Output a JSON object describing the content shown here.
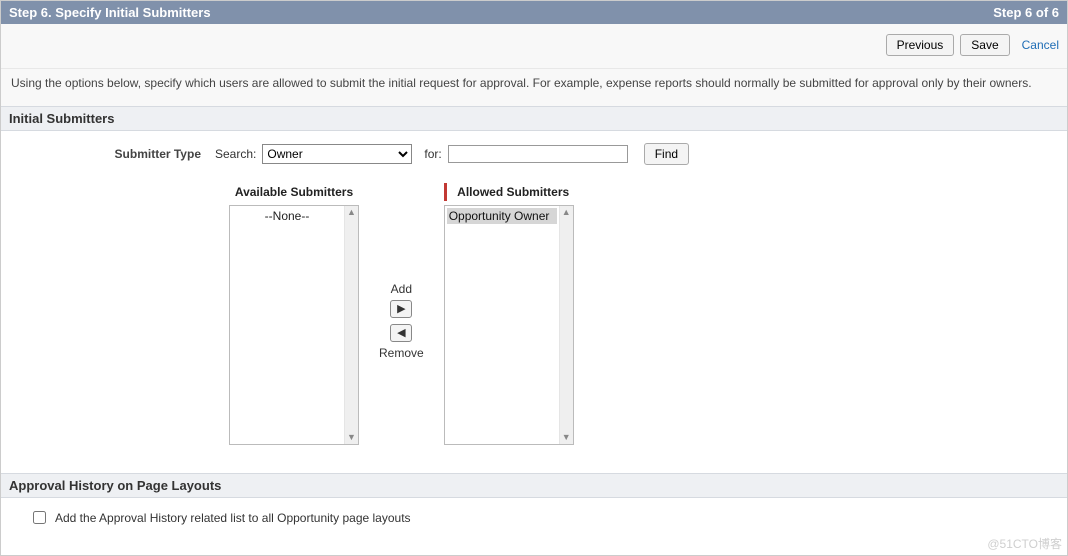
{
  "header": {
    "title": "Step 6. Specify Initial Submitters",
    "progress": "Step 6 of 6"
  },
  "toolbar": {
    "previous": "Previous",
    "save": "Save",
    "cancel": "Cancel"
  },
  "intro": "Using the options below, specify which users are allowed to submit the initial request for approval. For example, expense reports should normally be submitted for approval only by their owners.",
  "sections": {
    "initial_submitters": "Initial Submitters",
    "approval_history": "Approval History on Page Layouts"
  },
  "form": {
    "submitter_type_label": "Submitter Type",
    "search_label": "Search:",
    "search_select_value": "Owner",
    "for_label": "for:",
    "for_value": "",
    "find_btn": "Find"
  },
  "dual": {
    "available_header": "Available Submitters",
    "allowed_header": "Allowed Submitters",
    "available_items": {
      "none": "--None--"
    },
    "allowed_items": {
      "opportunity_owner": "Opportunity Owner"
    },
    "add_label": "Add",
    "remove_label": "Remove"
  },
  "options": {
    "add_history_label": "Add the Approval History related list to all Opportunity page layouts",
    "add_history_checked": false
  },
  "watermark": "@51CTO博客"
}
